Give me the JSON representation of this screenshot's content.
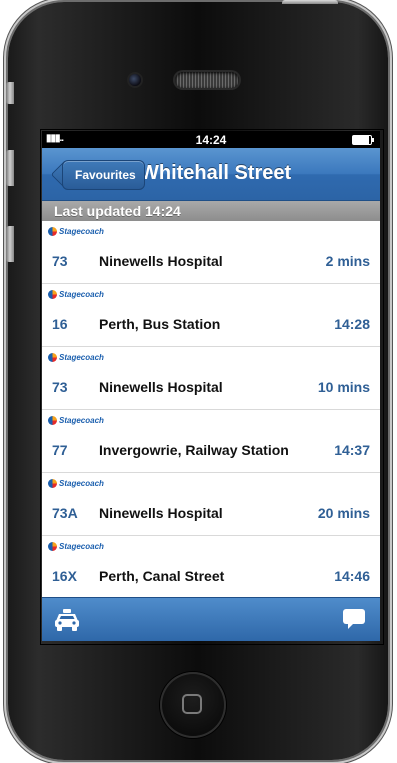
{
  "status_bar": {
    "time": "14:24"
  },
  "nav": {
    "back_label": "Favourites",
    "title": "Whitehall Street"
  },
  "updated_text": "Last updated 14:24",
  "operator_name": "Stagecoach",
  "departures": [
    {
      "route": "73",
      "destination": "Ninewells Hospital",
      "due": "2 mins"
    },
    {
      "route": "16",
      "destination": "Perth, Bus Station",
      "due": "14:28"
    },
    {
      "route": "73",
      "destination": "Ninewells Hospital",
      "due": "10 mins"
    },
    {
      "route": "77",
      "destination": "Invergowrie, Railway Station",
      "due": "14:37"
    },
    {
      "route": "73A",
      "destination": "Ninewells Hospital",
      "due": "20 mins"
    },
    {
      "route": "16X",
      "destination": "Perth, Canal Street",
      "due": "14:46"
    }
  ],
  "toolbar": {
    "left_icon": "taxi-icon",
    "right_icon": "chat-bubble-icon"
  },
  "colors": {
    "nav_blue": "#3b78bd",
    "route_blue": "#2f5f95",
    "updated_bar": "#9a9a9a"
  }
}
